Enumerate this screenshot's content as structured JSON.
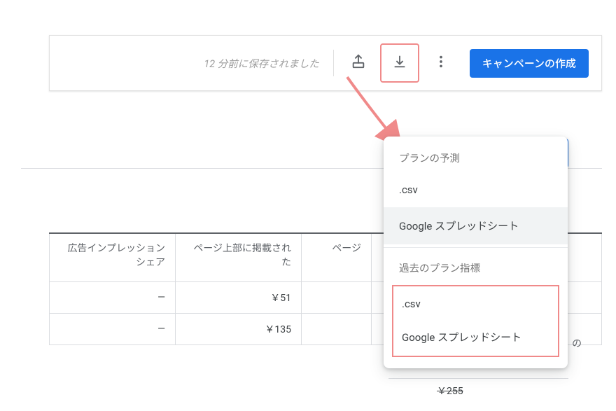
{
  "toolbar": {
    "save_status": "12 分前に保存されました",
    "primary_button": "キャンペーンの作成"
  },
  "table": {
    "headers": {
      "col1": "広告インプレッションシェア",
      "col2": "ページ上部に掲載された",
      "col3": "ページ"
    },
    "rows": [
      {
        "share": "—",
        "top": "￥51",
        "page": "",
        "rest": ""
      },
      {
        "share": "—",
        "top": "￥135",
        "page": "",
        "rest": ""
      }
    ]
  },
  "popup": {
    "section1_label": "プランの予測",
    "section1_items": {
      "csv": ".csv",
      "sheets": "Google スプレッドシート"
    },
    "section2_label": "過去のプラン指標",
    "section2_items": {
      "csv": ".csv",
      "sheets": "Google スプレッドシート"
    }
  },
  "bg": {
    "detail_char": "の",
    "cut_price": "￥255"
  }
}
